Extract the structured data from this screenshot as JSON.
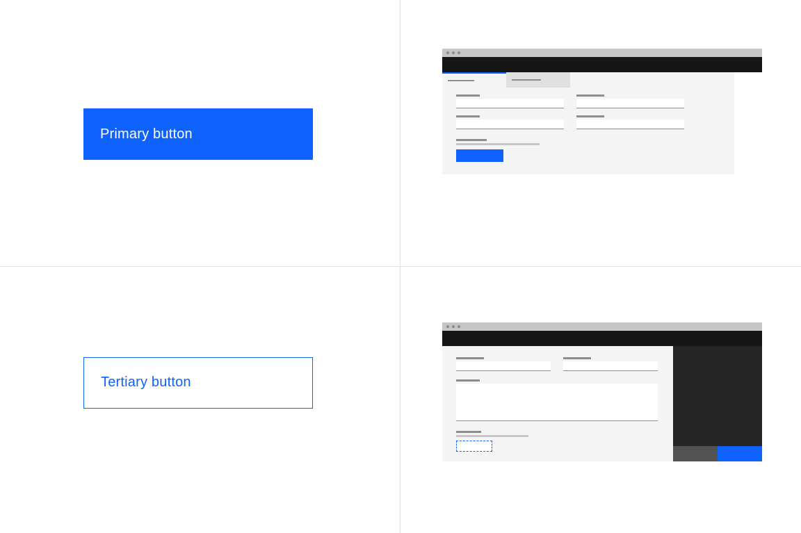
{
  "buttons": {
    "primary_label": "Primary button",
    "tertiary_label": "Tertiary button"
  },
  "colors": {
    "primary": "#0f62fe",
    "text_on_primary": "#ffffff",
    "border": "#e0e0e0",
    "wire_bg": "#f4f4f4",
    "wire_dark": "#262626",
    "wire_darker": "#161616"
  }
}
